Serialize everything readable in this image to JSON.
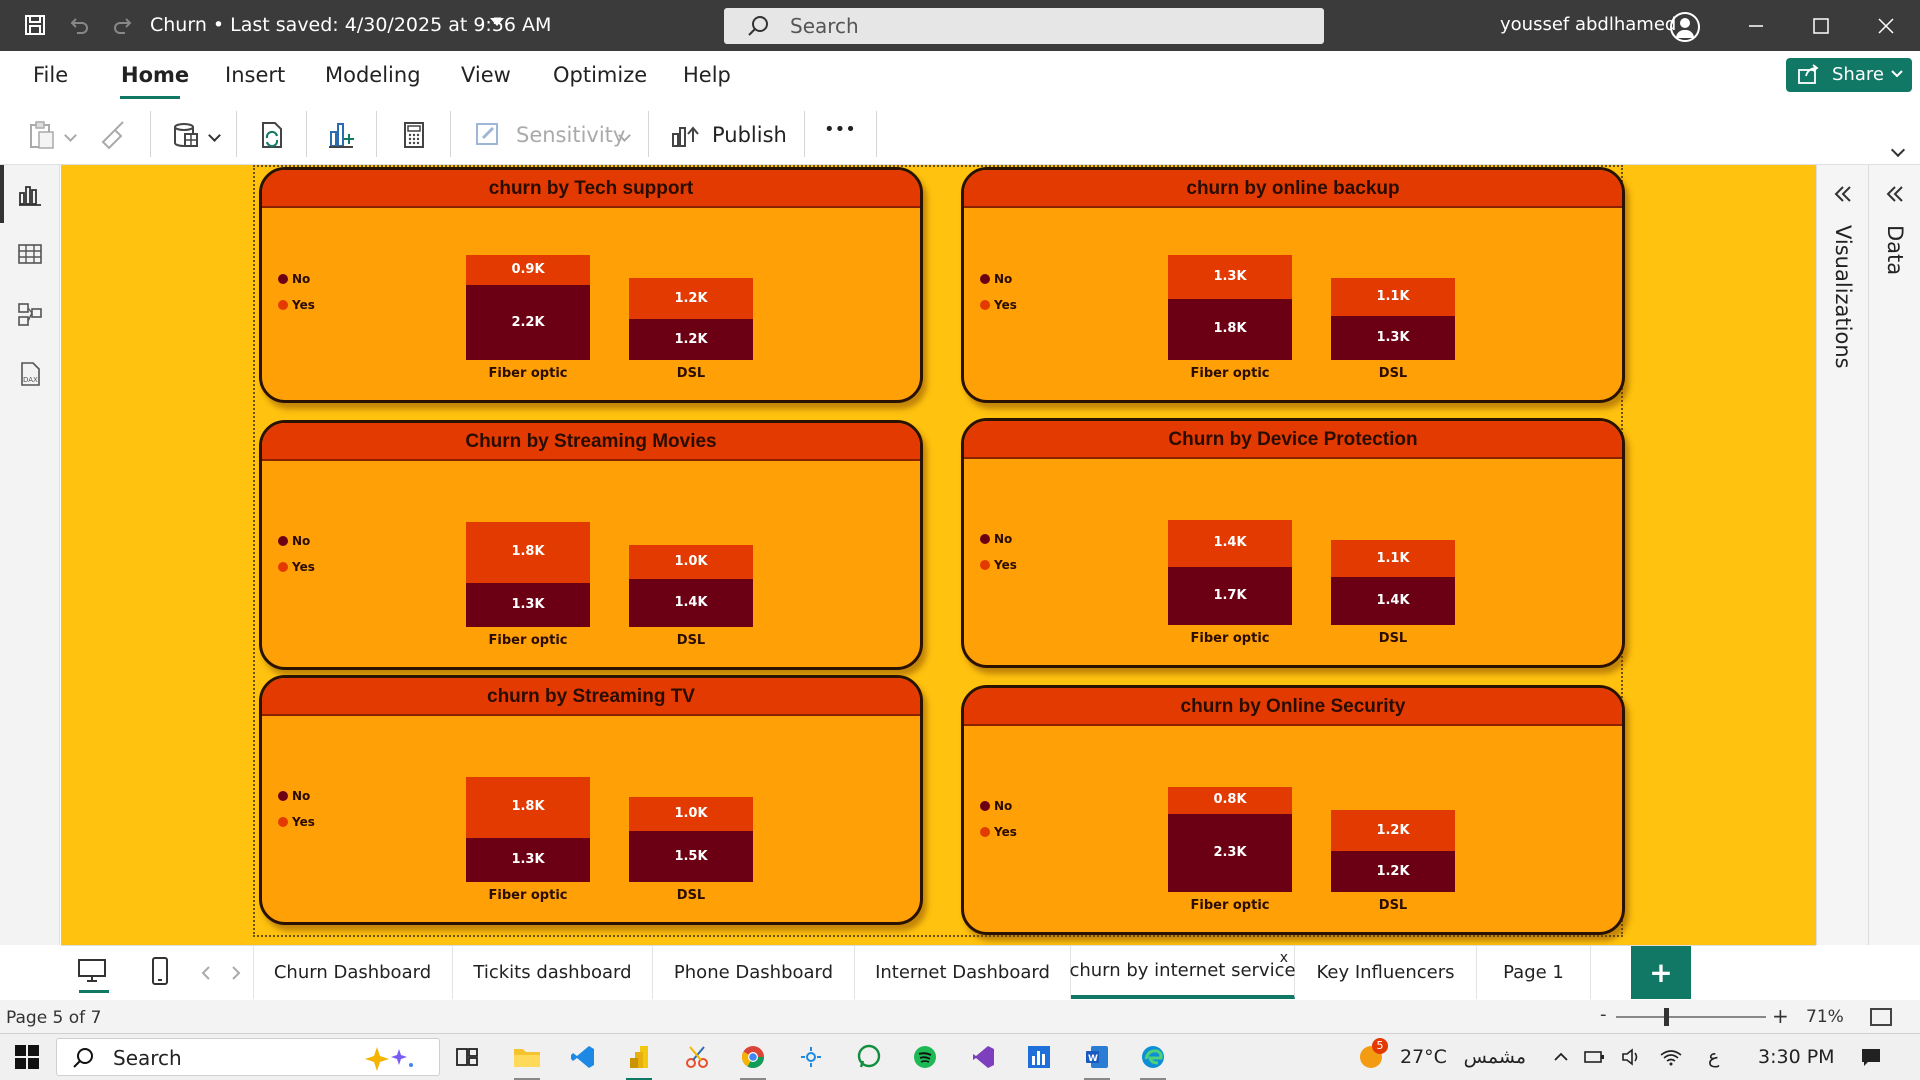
{
  "titlebar": {
    "title": "Churn • Last saved: 4/30/2025 at 9:56 AM",
    "search_placeholder": "Search",
    "user": "youssef abdlhamed"
  },
  "menu": {
    "items": [
      "File",
      "Home",
      "Insert",
      "Modeling",
      "View",
      "Optimize",
      "Help"
    ],
    "active": "Home",
    "share_label": "Share"
  },
  "ribbon": {
    "sensitivity_label": "Sensitivity",
    "publish_label": "Publish",
    "more_label": "•••"
  },
  "right_panes": {
    "visualizations": "Visualizations",
    "data": "Data"
  },
  "colors": {
    "no": "#6b0014",
    "yes": "#e23a00",
    "canvas": "#ffc20e",
    "card": "#ffa007",
    "accent": "#117865"
  },
  "legend": {
    "no": "No",
    "yes": "Yes"
  },
  "chart_data": [
    {
      "type": "bar",
      "stacked": true,
      "title": "churn by Tech support",
      "categories": [
        "Fiber optic",
        "DSL"
      ],
      "series": [
        {
          "name": "No",
          "values": [
            "2.2K",
            "1.2K"
          ],
          "raw": [
            2.2,
            1.2
          ]
        },
        {
          "name": "Yes",
          "values": [
            "0.9K",
            "1.2K"
          ],
          "raw": [
            0.9,
            1.2
          ]
        }
      ]
    },
    {
      "type": "bar",
      "stacked": true,
      "title": "churn by online backup",
      "categories": [
        "Fiber optic",
        "DSL"
      ],
      "series": [
        {
          "name": "No",
          "values": [
            "1.8K",
            "1.3K"
          ],
          "raw": [
            1.8,
            1.3
          ]
        },
        {
          "name": "Yes",
          "values": [
            "1.3K",
            "1.1K"
          ],
          "raw": [
            1.3,
            1.1
          ]
        }
      ]
    },
    {
      "type": "bar",
      "stacked": true,
      "title": "Churn by Streaming Movies",
      "categories": [
        "Fiber optic",
        "DSL"
      ],
      "series": [
        {
          "name": "No",
          "values": [
            "1.3K",
            "1.4K"
          ],
          "raw": [
            1.3,
            1.4
          ]
        },
        {
          "name": "Yes",
          "values": [
            "1.8K",
            "1.0K"
          ],
          "raw": [
            1.8,
            1.0
          ]
        }
      ]
    },
    {
      "type": "bar",
      "stacked": true,
      "title": "Churn by Device Protection",
      "categories": [
        "Fiber optic",
        "DSL"
      ],
      "series": [
        {
          "name": "No",
          "values": [
            "1.7K",
            "1.4K"
          ],
          "raw": [
            1.7,
            1.4
          ]
        },
        {
          "name": "Yes",
          "values": [
            "1.4K",
            "1.1K"
          ],
          "raw": [
            1.4,
            1.1
          ]
        }
      ]
    },
    {
      "type": "bar",
      "stacked": true,
      "title": "churn by Streaming TV",
      "categories": [
        "Fiber optic",
        "DSL"
      ],
      "series": [
        {
          "name": "No",
          "values": [
            "1.3K",
            "1.5K"
          ],
          "raw": [
            1.3,
            1.5
          ]
        },
        {
          "name": "Yes",
          "values": [
            "1.8K",
            "1.0K"
          ],
          "raw": [
            1.8,
            1.0
          ]
        }
      ]
    },
    {
      "type": "bar",
      "stacked": true,
      "title": "churn by Online Security",
      "categories": [
        "Fiber optic",
        "DSL"
      ],
      "series": [
        {
          "name": "No",
          "values": [
            "2.3K",
            "1.2K"
          ],
          "raw": [
            2.3,
            1.2
          ]
        },
        {
          "name": "Yes",
          "values": [
            "0.8K",
            "1.2K"
          ],
          "raw": [
            0.8,
            1.2
          ]
        }
      ]
    }
  ],
  "page_tabs": {
    "tabs": [
      "Churn Dashboard",
      "Tickits dashboard",
      "Phone Dashboard",
      "Internet Dashboard",
      "churn by internet service",
      "Key Influencers",
      "Page 1"
    ],
    "active": "churn by internet service",
    "close": "x",
    "add": "+"
  },
  "status": {
    "page": "Page 5 of 7",
    "zoom": "71%",
    "minus": "-",
    "plus": "+"
  },
  "taskbar": {
    "search": "Search",
    "weather_badge": "5",
    "temperature": "27°C",
    "weather": "مشمس",
    "lang": "ع",
    "time": "3:30 PM"
  }
}
